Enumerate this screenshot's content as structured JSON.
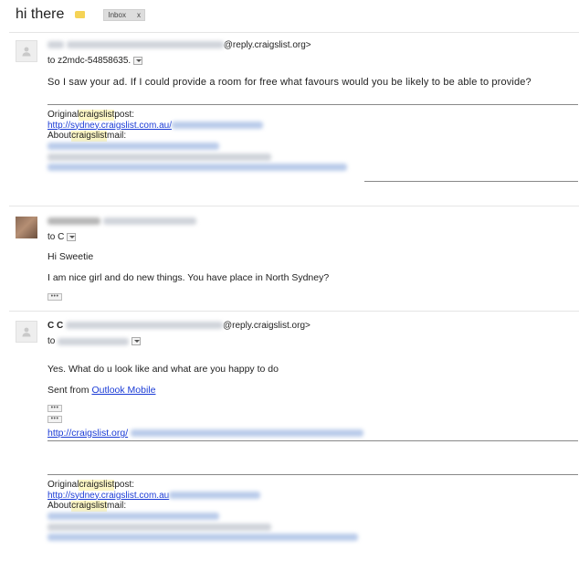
{
  "thread": {
    "subject": "hi there",
    "label_color": "#f5d356",
    "inbox_chip": {
      "label": "Inbox",
      "close": "x"
    }
  },
  "messages": [
    {
      "sender_suffix": "@reply.craigslist.org>",
      "to_label": "to z2mdc-54858635.",
      "body": "So I saw your ad.  If I could provide a room for free what favours would you be likely to be able to provide?",
      "signature": {
        "original_prefix": "Original ",
        "original_hl": "craigslist",
        "original_suffix": " post:",
        "post_link": "http://sydney.craigslist.com.au/",
        "about_prefix": "About ",
        "about_hl": "craigslist",
        "about_suffix": " mail:"
      }
    },
    {
      "to_label": "to C",
      "greeting": "Hi Sweetie",
      "body": "I am nice girl and do new things. You have place in North Sydney?"
    },
    {
      "sender_name": "C C",
      "sender_suffix": "@reply.craigslist.org>",
      "to_label": "to",
      "body": "Yes. What do u look like and what are you happy to do",
      "sent_from_prefix": "Sent from ",
      "sent_from_link": "Outlook Mobile",
      "footer_link": "http://craigslist.org/",
      "signature": {
        "original_prefix": "Original ",
        "original_hl": "craigslist",
        "original_suffix": " post:",
        "post_link": "http://sydney.craigslist.com.au",
        "about_prefix": "About ",
        "about_hl": "craigslist",
        "about_suffix": " mail:"
      }
    }
  ],
  "ellipsis": "•••",
  "icons": {
    "default_avatar": "person-silhouette-icon",
    "dropdown": "chevron-down-icon",
    "label": "label-tag-icon"
  }
}
